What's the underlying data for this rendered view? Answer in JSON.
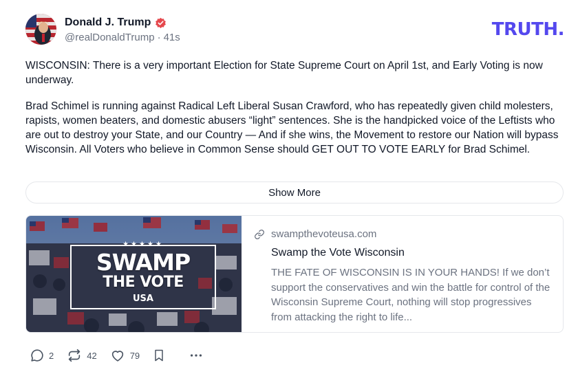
{
  "post": {
    "author": {
      "display_name": "Donald J. Trump",
      "handle": "@realDonaldTrump",
      "time": "41s",
      "verified": true
    },
    "brand_logo": "TRUTH.",
    "paragraphs": [
      "WISCONSIN: There is a very important Election for State Supreme Court on April 1st, and Early Voting is now underway.",
      "Brad Schimel is running against Radical Left Liberal Susan Crawford, who has repeatedly given child molesters, rapists, women beaters, and domestic abusers “light” sentences. She is the handpicked voice of the Leftists who are out to destroy your State, and our Country — And if she wins, the Movement to restore our Nation will bypass Wisconsin. All Voters who believe in Common Sense should GET OUT TO VOTE EARLY for Brad Schimel."
    ],
    "show_more_label": "Show More",
    "link_card": {
      "image_text": {
        "stars": "★★★★★",
        "line1": "SWAMP",
        "line2": "THE VOTE",
        "line3": "USA"
      },
      "domain": "swampthevoteusa.com",
      "title": "Swamp the Vote Wisconsin",
      "description": "THE FATE OF WISCONSIN IS IN YOUR HANDS! If we don’t support the conservatives and win the battle for control of the Wisconsin Supreme Court, nothing will stop progressives from attacking the right to life..."
    },
    "actions": {
      "reply_count": "2",
      "retruth_count": "42",
      "like_count": "79"
    },
    "icons": [
      "verified-icon",
      "link-icon",
      "reply-icon",
      "retruth-icon",
      "like-icon",
      "bookmark-icon",
      "more-icon"
    ],
    "colors": {
      "brand": "#5448ee",
      "verified": "#e5484d",
      "text": "#111827",
      "muted": "#6b7280"
    }
  }
}
